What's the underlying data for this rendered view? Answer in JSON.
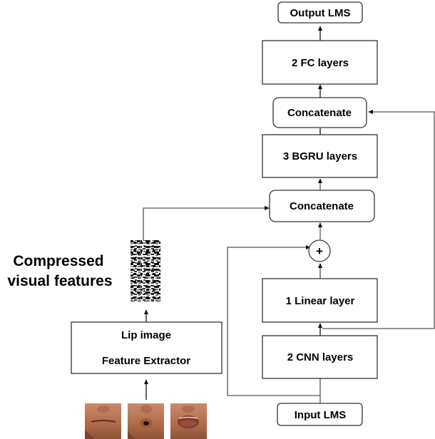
{
  "diagram": {
    "nodes": {
      "output_lms": "Output LMS",
      "fc_layers": "2 FC layers",
      "concat_top": "Concatenate",
      "bgru_layers": "3 BGRU layers",
      "concat_bottom": "Concatenate",
      "add_op": "+",
      "linear_layer": "1 Linear layer",
      "cnn_layers": "2 CNN layers",
      "input_lms": "Input LMS",
      "lip_extractor_line1": "Lip image",
      "lip_extractor_line2": "Feature Extractor"
    },
    "annotation": {
      "line1": "Compressed",
      "line2": "visual features"
    },
    "images": {
      "compressed_features": "compressed-visual-feature-map",
      "lip_frames": [
        "lip-frame-closed",
        "lip-frame-rounded",
        "lip-frame-open"
      ]
    },
    "edges": [
      {
        "from": "input_lms",
        "to": "cnn_layers"
      },
      {
        "from": "cnn_layers",
        "to": "linear_layer"
      },
      {
        "from": "linear_layer",
        "to": "add_op"
      },
      {
        "from": "input_lms",
        "to": "add_op",
        "kind": "skip"
      },
      {
        "from": "add_op",
        "to": "concat_bottom"
      },
      {
        "from": "compressed_features",
        "to": "concat_bottom"
      },
      {
        "from": "concat_bottom",
        "to": "bgru_layers"
      },
      {
        "from": "bgru_layers",
        "to": "concat_top"
      },
      {
        "from": "cnn_layers",
        "to": "concat_top",
        "kind": "skip"
      },
      {
        "from": "concat_top",
        "to": "fc_layers"
      },
      {
        "from": "fc_layers",
        "to": "output_lms"
      },
      {
        "from": "lip_frames",
        "to": "lip_extractor"
      },
      {
        "from": "lip_extractor",
        "to": "compressed_features"
      }
    ]
  }
}
